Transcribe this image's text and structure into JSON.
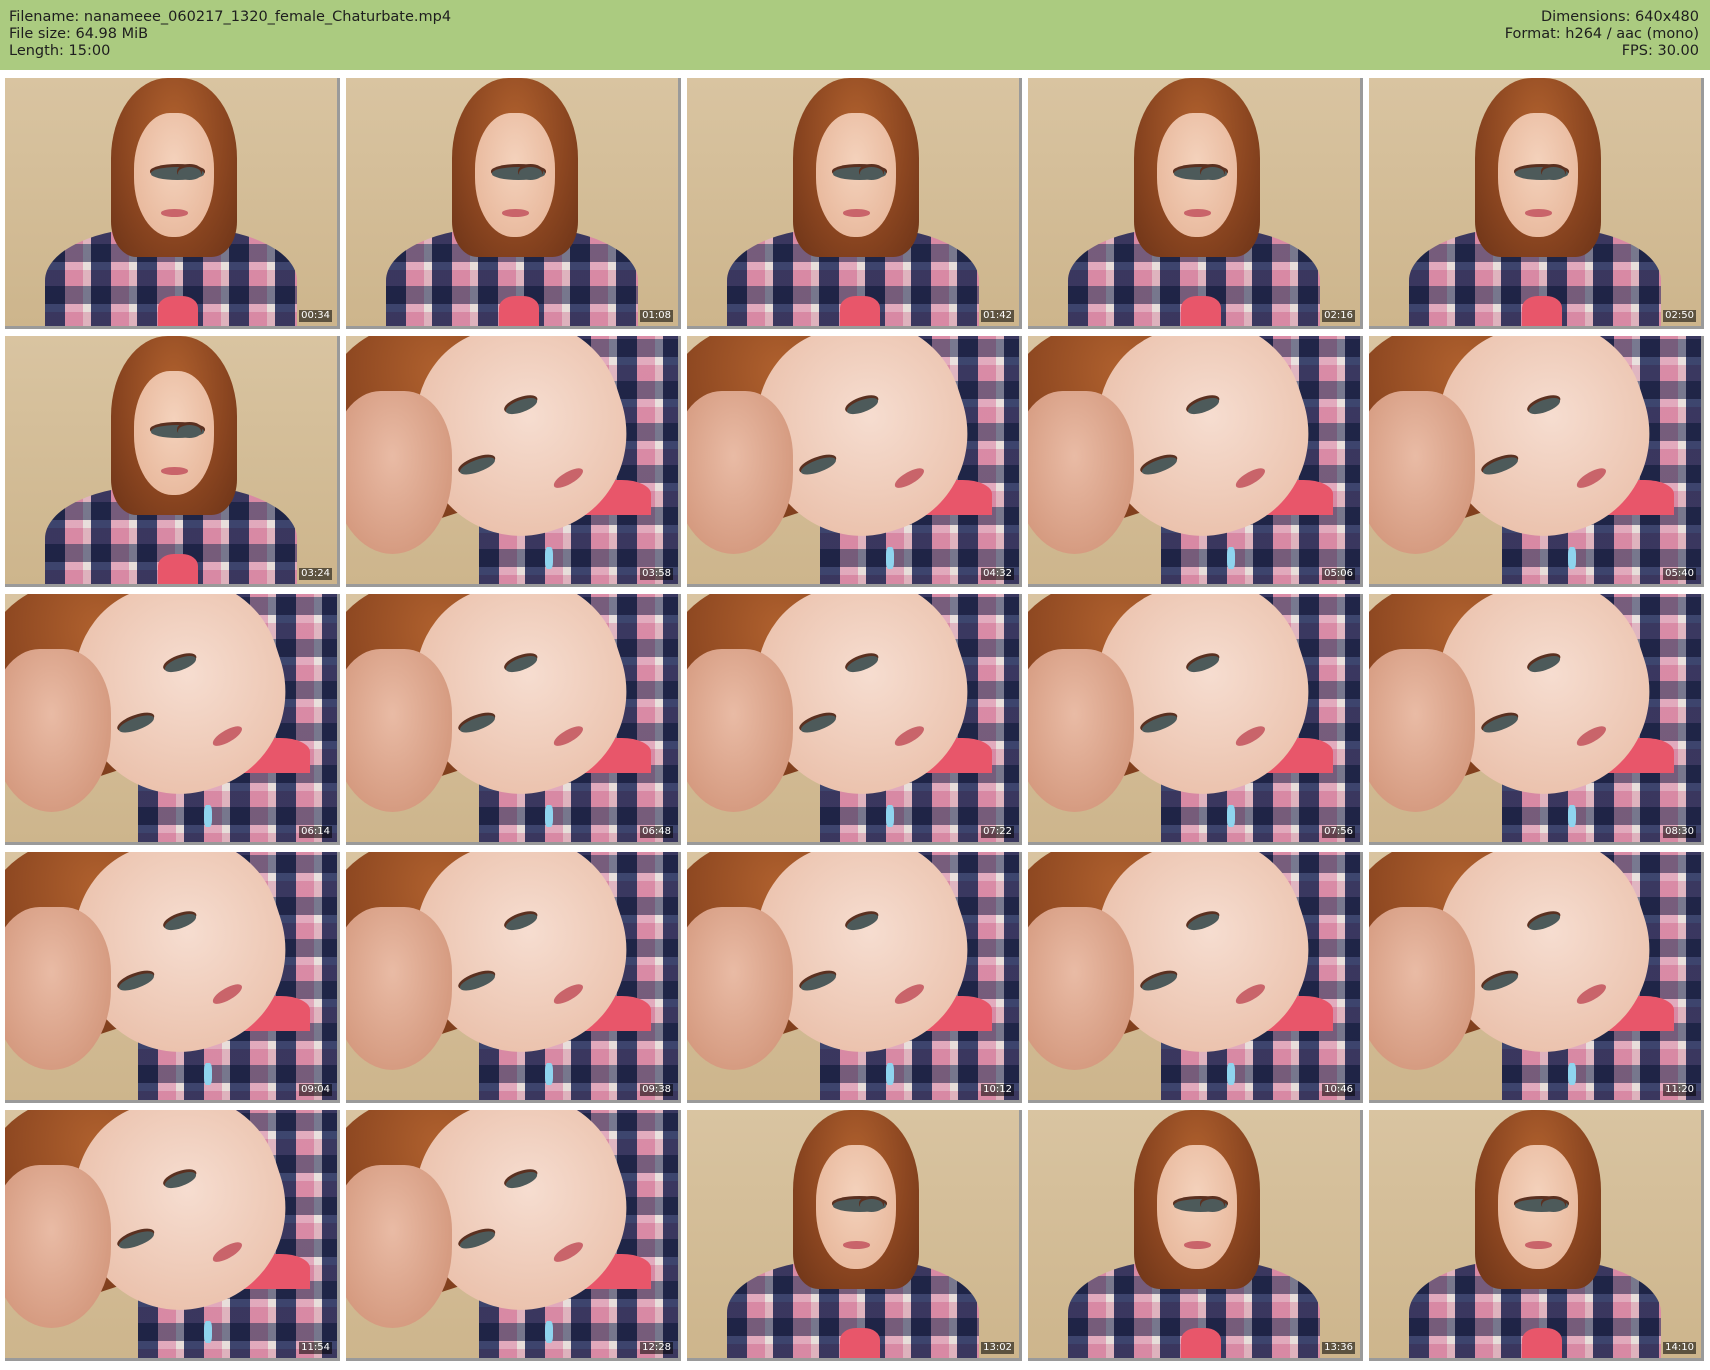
{
  "header": {
    "filename": "Filename: nanameee_060217_1320_female_Chaturbate.mp4",
    "filesize": "File size: 64.98 MiB",
    "length": "Length: 15:00",
    "dimensions": "Dimensions: 640x480",
    "format": "Format: h264 / aac (mono)",
    "fps": "FPS: 30.00"
  },
  "colors": {
    "header_bg": "#abcb80",
    "page_bg": "#ffffff"
  },
  "thumbnails": [
    {
      "timestamp": "00:34",
      "shot": "wide"
    },
    {
      "timestamp": "01:08",
      "shot": "wide"
    },
    {
      "timestamp": "01:42",
      "shot": "wide"
    },
    {
      "timestamp": "02:16",
      "shot": "wide"
    },
    {
      "timestamp": "02:50",
      "shot": "wide"
    },
    {
      "timestamp": "03:24",
      "shot": "wide"
    },
    {
      "timestamp": "03:58",
      "shot": "close"
    },
    {
      "timestamp": "04:32",
      "shot": "close"
    },
    {
      "timestamp": "05:06",
      "shot": "close"
    },
    {
      "timestamp": "05:40",
      "shot": "close"
    },
    {
      "timestamp": "06:14",
      "shot": "close"
    },
    {
      "timestamp": "06:48",
      "shot": "close"
    },
    {
      "timestamp": "07:22",
      "shot": "close"
    },
    {
      "timestamp": "07:56",
      "shot": "close"
    },
    {
      "timestamp": "08:30",
      "shot": "close"
    },
    {
      "timestamp": "09:04",
      "shot": "close"
    },
    {
      "timestamp": "09:38",
      "shot": "close"
    },
    {
      "timestamp": "10:12",
      "shot": "close"
    },
    {
      "timestamp": "10:46",
      "shot": "close"
    },
    {
      "timestamp": "11:20",
      "shot": "close"
    },
    {
      "timestamp": "11:54",
      "shot": "close"
    },
    {
      "timestamp": "12:28",
      "shot": "close"
    },
    {
      "timestamp": "13:02",
      "shot": "wide"
    },
    {
      "timestamp": "13:36",
      "shot": "wide"
    },
    {
      "timestamp": "14:10",
      "shot": "wide"
    }
  ]
}
